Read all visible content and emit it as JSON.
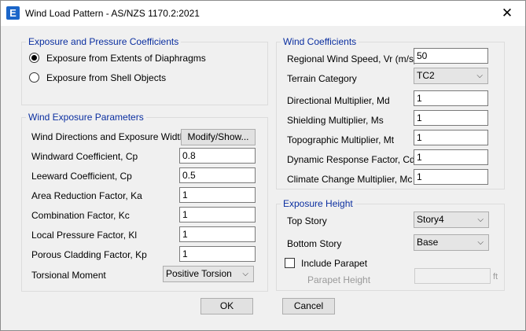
{
  "window": {
    "title": "Wind Load Pattern - AS/NZS 1170.2:2021",
    "icon": "etabs-app-icon",
    "close_glyph": "✕"
  },
  "exposure_pressure": {
    "title": "Exposure and Pressure Coefficients",
    "options": [
      {
        "label": "Exposure from Extents of Diaphragms",
        "checked": true
      },
      {
        "label": "Exposure from Shell Objects",
        "checked": false
      }
    ]
  },
  "wind_exposure": {
    "title": "Wind Exposure Parameters",
    "directions_label": "Wind Directions and Exposure Widths",
    "modify_button": "Modify/Show...",
    "windward_label": "Windward Coefficient, Cp",
    "windward_value": "0.8",
    "leeward_label": "Leeward Coefficient, Cp",
    "leeward_value": "0.5",
    "area_reduction_label": "Area Reduction Factor, Ka",
    "area_reduction_value": "1",
    "combination_label": "Combination Factor, Kc",
    "combination_value": "1",
    "local_pressure_label": "Local Pressure Factor, Kl",
    "local_pressure_value": "1",
    "porous_label": "Porous Cladding Factor, Kp",
    "porous_value": "1",
    "torsional_label": "Torsional Moment",
    "torsional_value": "Positive Torsion"
  },
  "wind_coefficients": {
    "title": "Wind Coefficients",
    "regional_speed_label": "Regional Wind Speed, Vr (m/s)",
    "regional_speed_value": "50",
    "terrain_label": "Terrain Category",
    "terrain_value": "TC2",
    "directional_label": "Directional Multiplier, Md",
    "directional_value": "1",
    "shielding_label": "Shielding Multiplier, Ms",
    "shielding_value": "1",
    "topographic_label": "Topographic Multiplier, Mt",
    "topographic_value": "1",
    "dynamic_label": "Dynamic Response Factor, Cdyn",
    "dynamic_value": "1",
    "climate_label": "Climate Change Multiplier, Mc",
    "climate_value": "1"
  },
  "exposure_height": {
    "title": "Exposure Height",
    "top_story_label": "Top Story",
    "top_story_value": "Story4",
    "bottom_story_label": "Bottom Story",
    "bottom_story_value": "Base",
    "include_parapet_label": "Include Parapet",
    "include_parapet_checked": false,
    "parapet_height_label": "Parapet Height",
    "parapet_height_value": "",
    "parapet_unit": "ft"
  },
  "buttons": {
    "ok": "OK",
    "cancel": "Cancel"
  },
  "icons": {
    "dropdown": "chevron-down-icon",
    "dropdown_glyph": "⌵"
  },
  "colors": {
    "group_title": "#0b2fa0",
    "app_icon": "#1b66c9"
  }
}
